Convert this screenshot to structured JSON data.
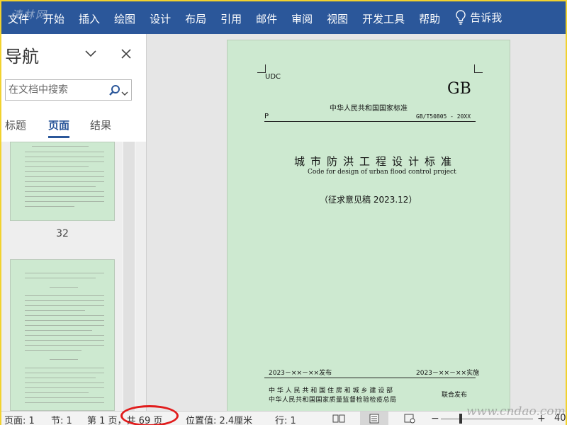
{
  "watermark_top": "清林网",
  "watermark_bottom": "www.cndao.com",
  "ribbon": {
    "tabs": [
      "文件",
      "开始",
      "插入",
      "绘图",
      "设计",
      "布局",
      "引用",
      "邮件",
      "审阅",
      "视图",
      "开发工具",
      "帮助"
    ],
    "tell_me": "告诉我",
    "color": "#2b579a"
  },
  "nav": {
    "title": "导航",
    "search_placeholder": "在文档中搜索",
    "tabs": [
      "标题",
      "页面",
      "结果"
    ],
    "active_tab": "页面",
    "thumbnail_page": "32"
  },
  "document": {
    "udc": "UDC",
    "gb": "GB",
    "std_title": "中华人民共和国国家标准",
    "p": "P",
    "code": "GB/T50805 - 20XX",
    "name_cn": "城市防洪工程设计标准",
    "name_en": "Code for design of urban flood control project",
    "draft": "（征求意见稿 2023.12）",
    "publish": "2023－××－××发布",
    "implement": "2023－××－××实施",
    "issuer_1": "中 华 人 民 共 和 国 住 房 和 城 乡 建 设 部",
    "issuer_2": "中华人民共和国国家质量监督检验检疫总局",
    "joint": "联合发布",
    "page_color": "#cde9d0"
  },
  "status": {
    "page": "页面: 1",
    "section": "节: 1",
    "page_of": "第 1 页，共 69 页",
    "position": "位置值: 2.4厘米",
    "line": "行: 1",
    "zoom": "40"
  }
}
